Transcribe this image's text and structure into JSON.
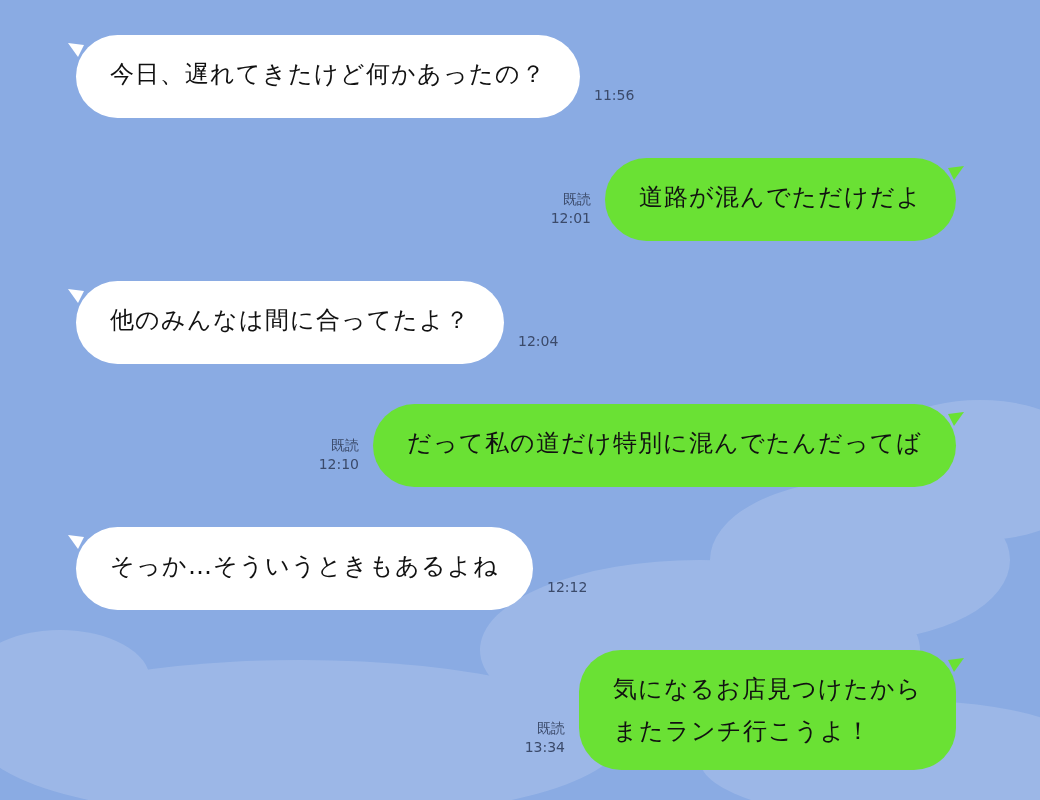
{
  "messages": [
    {
      "kind": "incoming",
      "text": "今日、遅れてきたけど何かあったの？",
      "time": "11:56"
    },
    {
      "kind": "outgoing",
      "text": "道路が混んでただけだよ",
      "read_label": "既読",
      "time": "12:01"
    },
    {
      "kind": "incoming",
      "text": "他のみんなは間に合ってたよ？",
      "time": "12:04"
    },
    {
      "kind": "outgoing",
      "text": "だって私の道だけ特別に混んでたんだってば",
      "read_label": "既読",
      "time": "12:10"
    },
    {
      "kind": "incoming",
      "text": "そっか…そういうときもあるよね",
      "time": "12:12"
    },
    {
      "kind": "outgoing",
      "lines": [
        "気になるお店見つけたから",
        "またランチ行こうよ！"
      ],
      "read_label": "既読",
      "time": "13:34"
    }
  ]
}
